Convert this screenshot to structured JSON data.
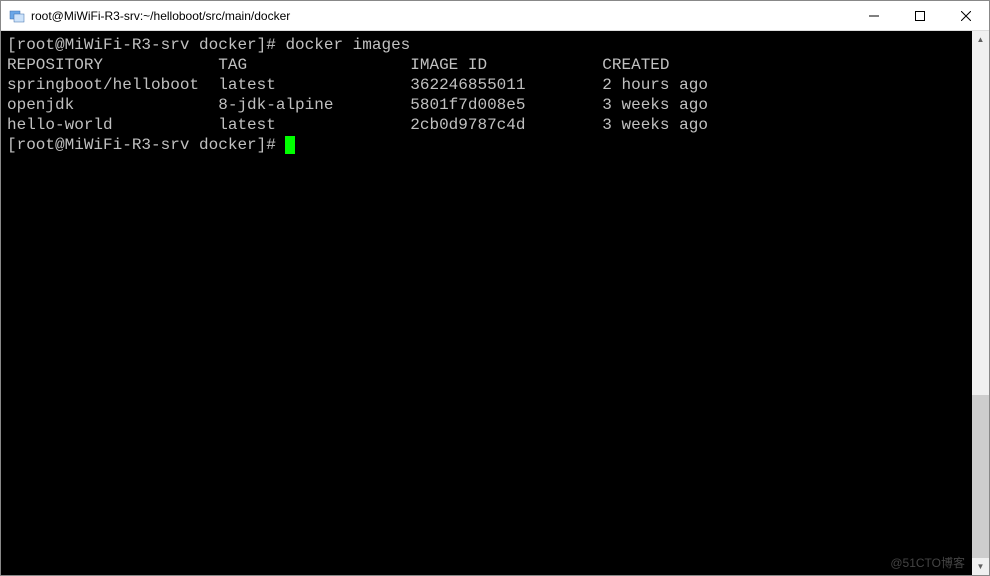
{
  "window": {
    "title": "root@MiWiFi-R3-srv:~/helloboot/src/main/docker"
  },
  "terminal": {
    "prompt1_user": "[root@MiWiFi-R3-srv docker]# ",
    "command1": "docker images",
    "headers": {
      "repository": "REPOSITORY",
      "tag": "TAG",
      "image_id": "IMAGE ID",
      "created": "CREATED"
    },
    "rows": [
      {
        "repository": "springboot/helloboot",
        "tag": "latest",
        "image_id": "362246855011",
        "created": "2 hours ago"
      },
      {
        "repository": "openjdk",
        "tag": "8-jdk-alpine",
        "image_id": "5801f7d008e5",
        "created": "3 weeks ago"
      },
      {
        "repository": "hello-world",
        "tag": "latest",
        "image_id": "2cb0d9787c4d",
        "created": "3 weeks ago"
      }
    ],
    "prompt2_user": "[root@MiWiFi-R3-srv docker]# "
  },
  "watermark": "@51CTO博客",
  "layout": {
    "col_repo": 22,
    "col_tag": 20,
    "col_id": 20
  }
}
